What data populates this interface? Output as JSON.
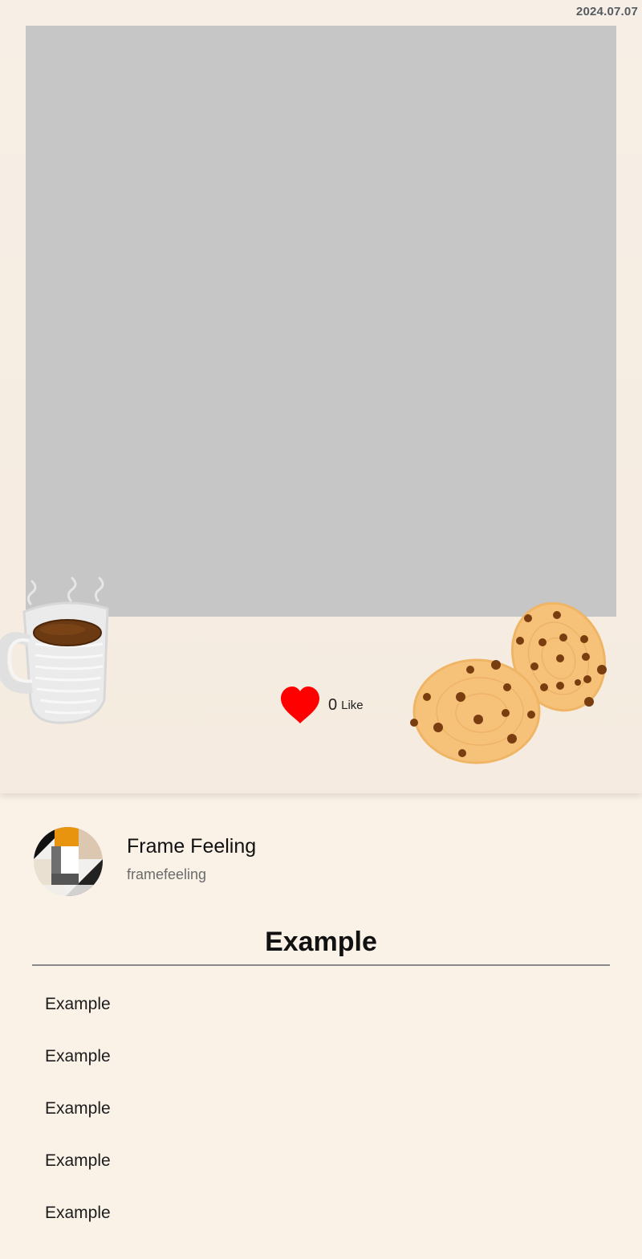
{
  "post": {
    "date": "2024.07.07",
    "like_count": "0",
    "like_label": "Like"
  },
  "profile": {
    "name": "Frame Feeling",
    "handle": "framefeeling"
  },
  "section": {
    "title": "Example",
    "items": [
      "Example",
      "Example",
      "Example",
      "Example",
      "Example"
    ]
  },
  "colors": {
    "background": "#faf1e7",
    "photo_placeholder": "#c6c6c6",
    "heart": "#ff0000",
    "divider": "#88888e"
  },
  "icons": {
    "like": "heart-icon",
    "decor_left": "coffee-mug-illustration",
    "decor_right": "cookies-illustration"
  }
}
